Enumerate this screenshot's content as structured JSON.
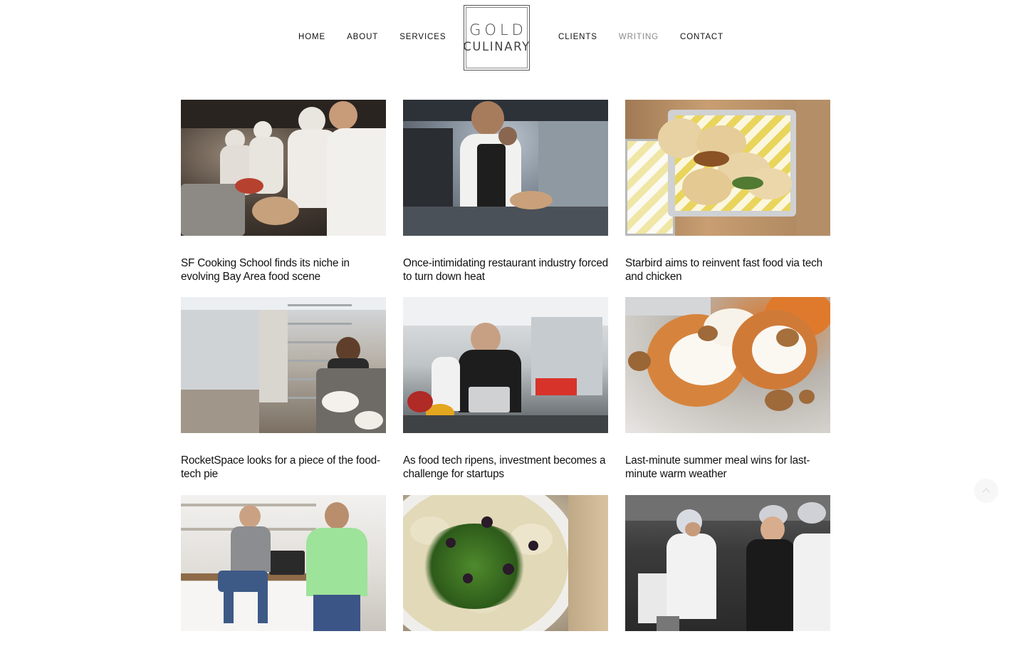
{
  "header": {
    "nav_left": [
      {
        "label": "HOME"
      },
      {
        "label": "ABOUT"
      },
      {
        "label": "SERVICES"
      }
    ],
    "nav_right": [
      {
        "label": "CLIENTS"
      },
      {
        "label": "WRITING",
        "active": true
      },
      {
        "label": "CONTACT"
      }
    ],
    "logo": {
      "line1": "GOLD",
      "line2": "CULINARY"
    }
  },
  "articles": [
    {
      "title": "SF Cooking School finds its niche in evolving Bay Area food scene",
      "image": "chefs-in-kitchen-photo"
    },
    {
      "title": "Once-intimidating restaurant industry forced to turn down heat",
      "image": "smiling-chef-photo"
    },
    {
      "title": "Starbird aims to reinvent fast food via tech and chicken",
      "image": "chicken-sandwiches-photo"
    },
    {
      "title": "RocketSpace looks for a piece of the food-tech pie",
      "image": "chef-plating-photo"
    },
    {
      "title": "As food tech ripens, investment becomes a challenge for startups",
      "image": "chef-with-laptop-photo"
    },
    {
      "title": "Last-minute summer meal wins for last-minute warm weather",
      "image": "stuffed-squash-photo"
    },
    {
      "title": "",
      "image": "two-founders-photo"
    },
    {
      "title": "",
      "image": "ravioli-bowl-photo"
    },
    {
      "title": "",
      "image": "cooks-laughing-photo"
    }
  ],
  "colors": {
    "active_nav": "#8a8a8a",
    "text": "#111111",
    "logo_border": "#555555"
  },
  "icons": {
    "scroll_top": "chevron-up-icon"
  }
}
